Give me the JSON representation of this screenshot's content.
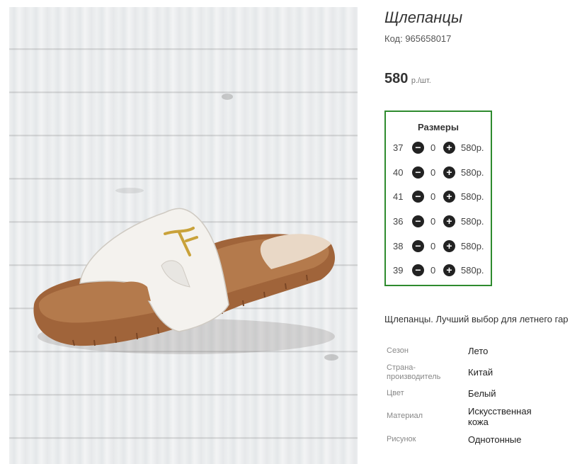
{
  "product": {
    "title": "Щлепанцы",
    "code": "Код: 965658017",
    "price_value": "580",
    "price_unit": "р./шт."
  },
  "sizes_box": {
    "heading": "Размеры",
    "rows": [
      {
        "size": "37",
        "qty": "0",
        "price": "580р."
      },
      {
        "size": "40",
        "qty": "0",
        "price": "580р."
      },
      {
        "size": "41",
        "qty": "0",
        "price": "580р."
      },
      {
        "size": "36",
        "qty": "0",
        "price": "580р."
      },
      {
        "size": "38",
        "qty": "0",
        "price": "580р."
      },
      {
        "size": "39",
        "qty": "0",
        "price": "580р."
      }
    ]
  },
  "description": "Щлепанцы. Лучший выбор для летнего гар",
  "properties": [
    {
      "name": "Сезон",
      "value": "Лето"
    },
    {
      "name": "Страна-\nпроизводитель",
      "value": "Китай"
    },
    {
      "name": "Цвет",
      "value": "Белый"
    },
    {
      "name": "Материал",
      "value": "Искусственная\nкожа"
    },
    {
      "name": "Рисунок",
      "value": "Однотонные"
    }
  ],
  "colors": {
    "accent_border": "#2e8b2e",
    "sole": "#a0643a",
    "strap": "#f4f2ee"
  },
  "icons": {
    "minus": "minus-circle-icon",
    "plus": "plus-circle-icon"
  }
}
